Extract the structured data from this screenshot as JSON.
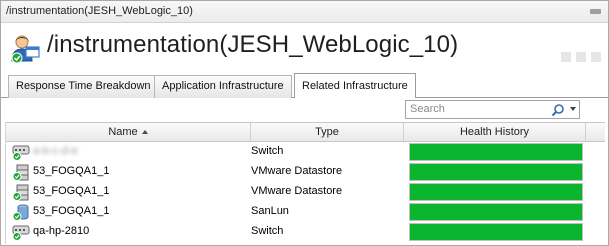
{
  "window": {
    "title": "/instrumentation(JESH_WebLogic_10)"
  },
  "header": {
    "page_title": "/instrumentation(JESH_WebLogic_10)"
  },
  "tabs": [
    {
      "label": "Response Time Breakdown",
      "active": false
    },
    {
      "label": "Application Infrastructure",
      "active": false
    },
    {
      "label": "Related Infrastructure",
      "active": true
    }
  ],
  "search": {
    "placeholder": "Search"
  },
  "table": {
    "columns": [
      {
        "label": "Name",
        "sort": "ascending"
      },
      {
        "label": "Type"
      },
      {
        "label": "Health History"
      }
    ],
    "rows": [
      {
        "name": "a-b-c-d-e",
        "type": "Switch",
        "icon": "switch-icon",
        "health": 1.0,
        "name_obscured": true
      },
      {
        "name": "53_FOGQA1_1",
        "type": "VMware Datastore",
        "icon": "datastore-icon",
        "health": 1.0
      },
      {
        "name": "53_FOGQA1_1",
        "type": "VMware Datastore",
        "icon": "datastore-icon",
        "health": 1.0
      },
      {
        "name": "53_FOGQA1_1",
        "type": "SanLun",
        "icon": "san-lun-icon",
        "health": 1.0
      },
      {
        "name": "qa-hp-2810",
        "type": "Switch",
        "icon": "switch-icon",
        "health": 1.0
      }
    ]
  },
  "colors": {
    "health_good": "#0cb52f",
    "status_ok": "#1fa53a"
  }
}
